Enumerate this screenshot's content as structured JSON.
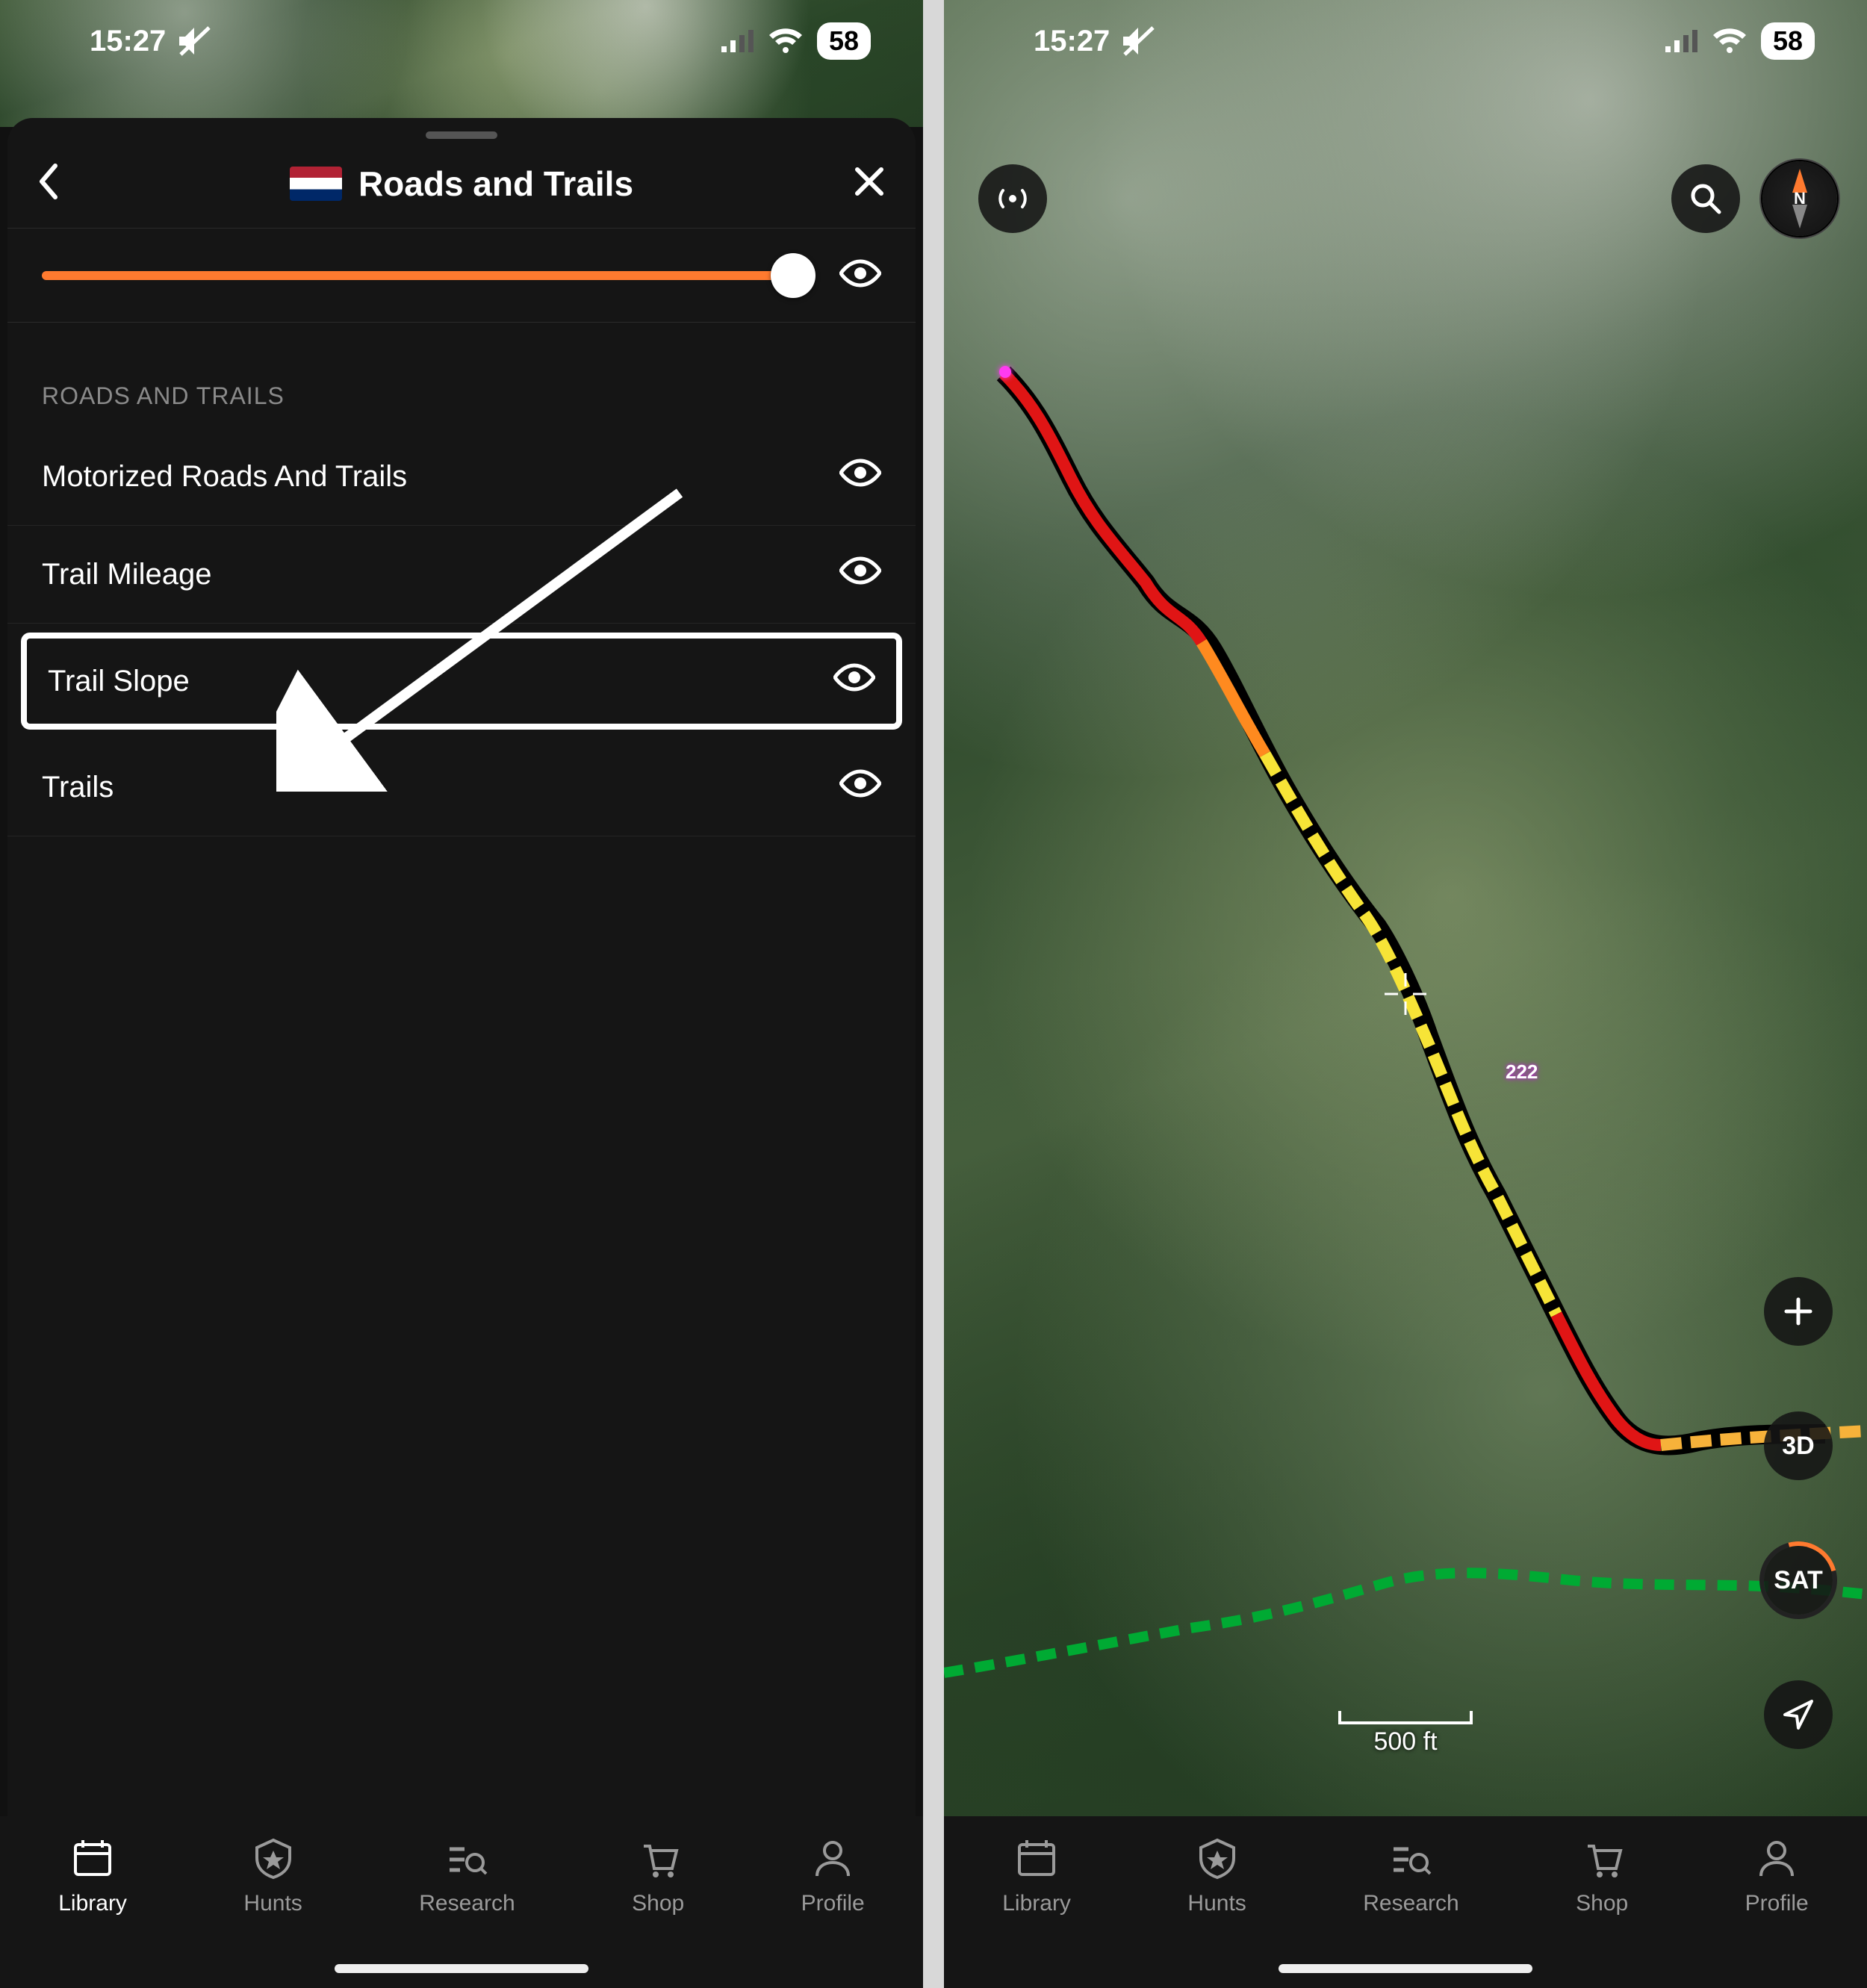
{
  "status": {
    "time": "15:27",
    "battery": "58"
  },
  "sheet": {
    "title": "Roads and Trails",
    "section_label": "ROADS AND TRAILS",
    "layers": [
      {
        "label": "Motorized Roads And Trails",
        "highlight": false
      },
      {
        "label": "Trail Mileage",
        "highlight": false
      },
      {
        "label": "Trail Slope",
        "highlight": true
      },
      {
        "label": "Trails",
        "highlight": false
      }
    ]
  },
  "tabs": {
    "library": "Library",
    "hunts": "Hunts",
    "research": "Research",
    "shop": "Shop",
    "profile": "Profile"
  },
  "map": {
    "scale": "500 ft",
    "btn_3d": "3D",
    "btn_sat": "SAT",
    "compass": "N",
    "trail_marker": "222"
  }
}
